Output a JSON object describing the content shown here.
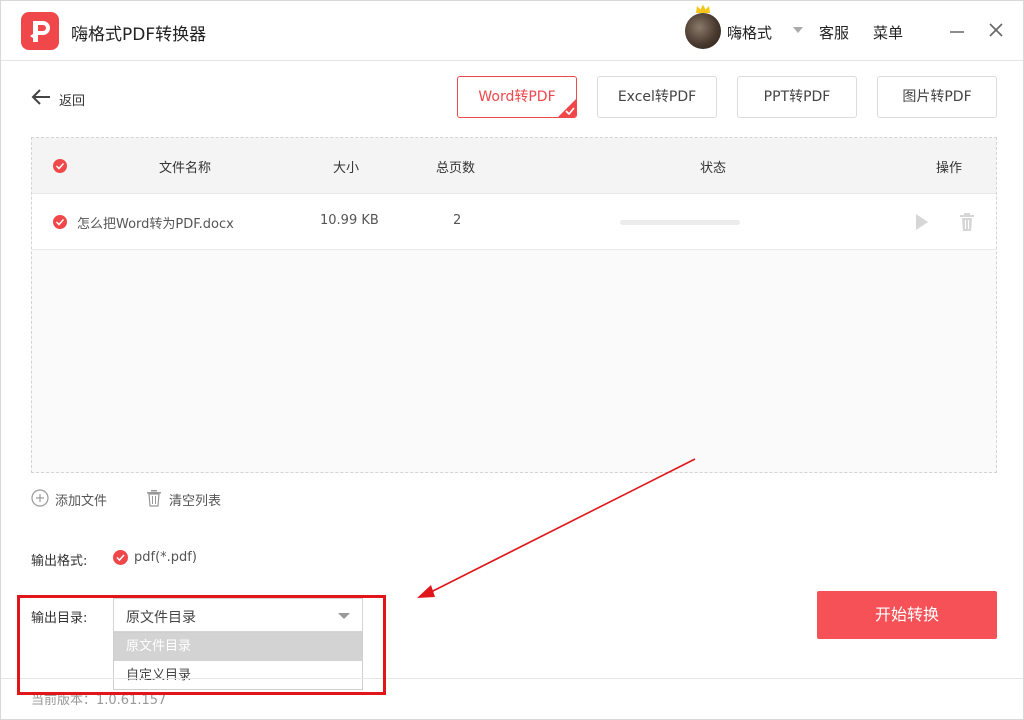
{
  "app": {
    "title": "嗨格式PDF转换器"
  },
  "user": {
    "name": "嗨格式"
  },
  "header_menu": {
    "service": "客服",
    "menu": "菜单"
  },
  "nav": {
    "back_label": "返回"
  },
  "tabs": [
    {
      "label": "Word转PDF",
      "active": true
    },
    {
      "label": "Excel转PDF",
      "active": false
    },
    {
      "label": "PPT转PDF",
      "active": false
    },
    {
      "label": "图片转PDF",
      "active": false
    }
  ],
  "file_table": {
    "columns": {
      "name": "文件名称",
      "size": "大小",
      "pages": "总页数",
      "status": "状态",
      "actions": "操作"
    },
    "rows": [
      {
        "name": "怎么把Word转为PDF.docx",
        "size": "10.99 KB",
        "pages": "2",
        "progress": 0
      }
    ]
  },
  "list_actions": {
    "add_file": "添加文件",
    "clear_list": "清空列表"
  },
  "output": {
    "format_label": "输出格式:",
    "format_value": "pdf(*.pdf)",
    "dir_label": "输出目录:",
    "dir_selected": "原文件目录",
    "dir_options": [
      "原文件目录",
      "自定义目录"
    ]
  },
  "start_button": "开始转换",
  "version": "当前版本：1.0.61.157",
  "colors": {
    "accent": "#f0474b",
    "annotation_red": "#e0161b"
  }
}
